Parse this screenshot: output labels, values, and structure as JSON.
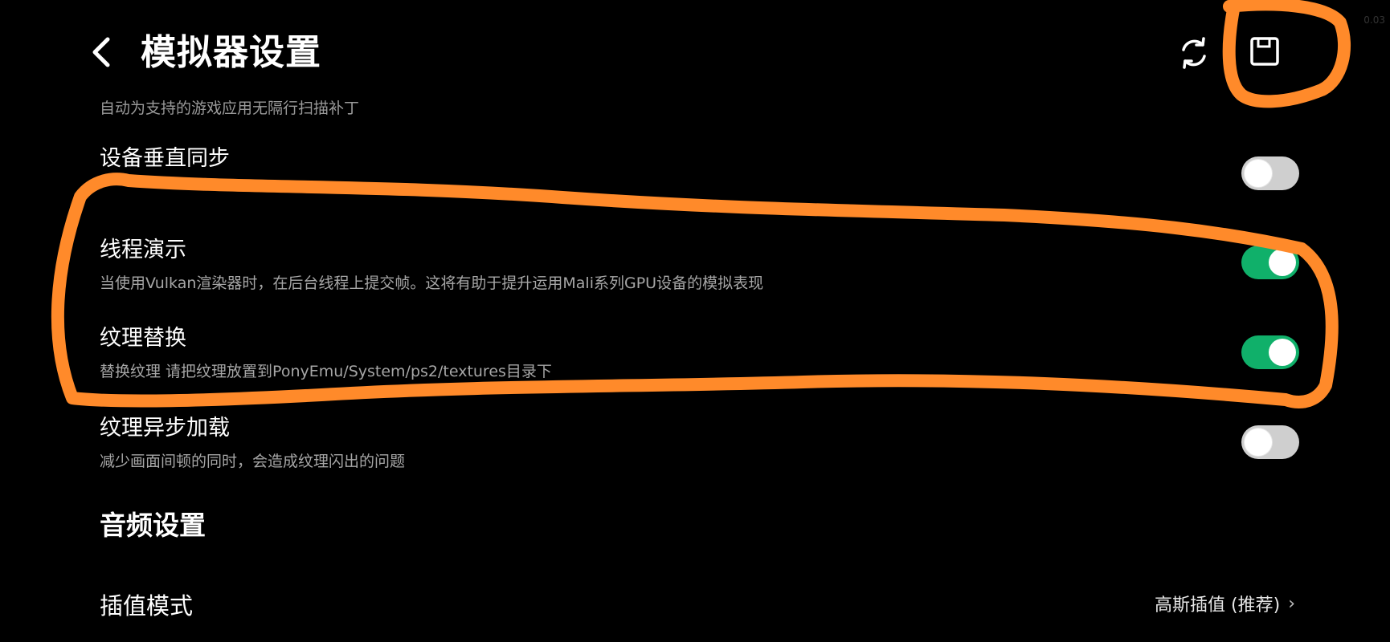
{
  "header": {
    "title": "模拟器设置",
    "corner_text": "0.03"
  },
  "partial_description": "自动为支持的游戏应用无隔行扫描补丁",
  "settings": [
    {
      "title": "设备垂直同步",
      "description": "",
      "state": "off"
    },
    {
      "title": "线程演示",
      "description": "当使用Vulkan渲染器时，在后台线程上提交帧。这将有助于提升运用Mali系列GPU设备的模拟表现",
      "state": "on"
    },
    {
      "title": "纹理替换",
      "description": "替换纹理 请把纹理放置到PonyEmu/System/ps2/textures目录下",
      "state": "on"
    },
    {
      "title": "纹理异步加载",
      "description": "减少画面间顿的同时，会造成纹理闪出的问题",
      "state": "off"
    }
  ],
  "audio": {
    "section_title": "音频设置",
    "interpolation_label": "插值模式",
    "interpolation_value": "高斯插值 (推荐)"
  },
  "colors": {
    "toggle_on": "#10b06a",
    "toggle_off": "#cfcfcf",
    "annotation": "#ff8a2a"
  },
  "icons": [
    "back-icon",
    "refresh-icon",
    "save-icon",
    "chevron-right-icon"
  ]
}
